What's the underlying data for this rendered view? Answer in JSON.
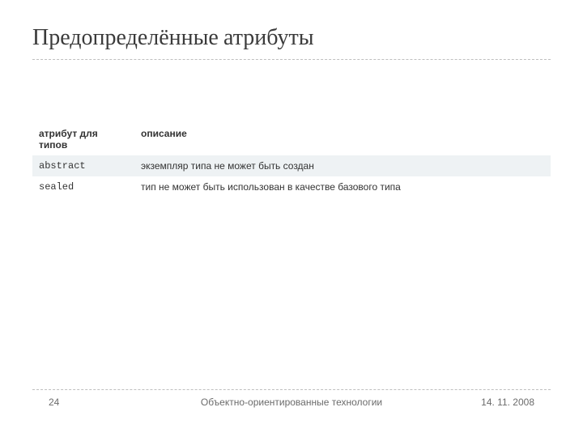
{
  "title": "Предопределённые атрибуты",
  "table": {
    "headers": {
      "attr": "атрибут для типов",
      "desc": "описание"
    },
    "rows": [
      {
        "attr": "abstract",
        "desc": "экземпляр типа не может быть создан"
      },
      {
        "attr": "sealed",
        "desc": "тип не может быть использован в качестве базового типа"
      }
    ]
  },
  "footer": {
    "page": "24",
    "center": "Объектно-ориентированные технологии",
    "date": "14. 11. 2008"
  }
}
